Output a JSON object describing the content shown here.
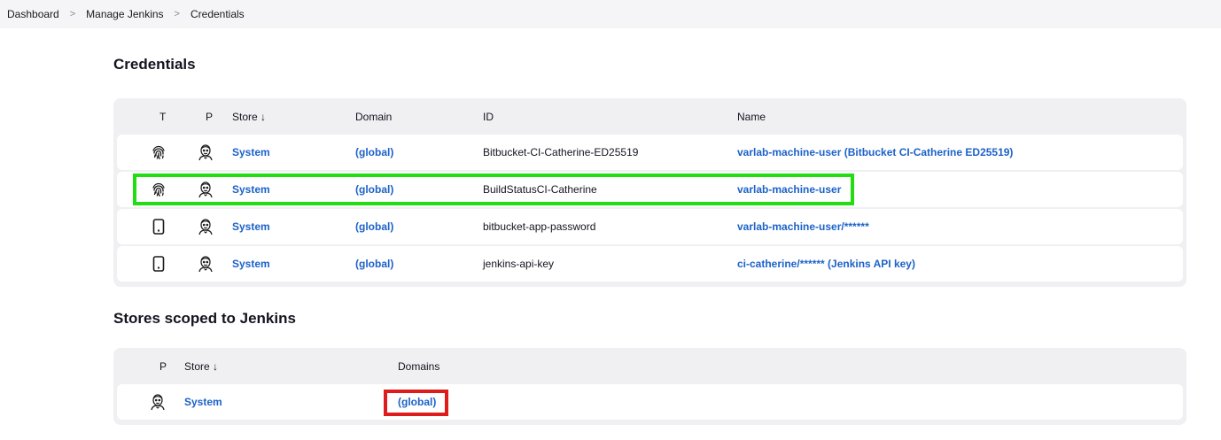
{
  "breadcrumb": [
    "Dashboard",
    "Manage Jenkins",
    "Credentials"
  ],
  "breadcrumb_separator": ">",
  "credentials": {
    "title": "Credentials",
    "columns": {
      "t": "T",
      "p": "P",
      "store": "Store ↓",
      "domain": "Domain",
      "id": "ID",
      "name": "Name"
    },
    "rows": [
      {
        "type_icon": "fingerprint-icon",
        "provider_icon": "jenkins-butler-icon",
        "store": "System",
        "domain": "(global)",
        "id": "Bitbucket-CI-Catherine-ED25519",
        "name": "varlab-machine-user (Bitbucket CI-Catherine ED25519)"
      },
      {
        "type_icon": "fingerprint-icon",
        "provider_icon": "jenkins-butler-icon",
        "store": "System",
        "domain": "(global)",
        "id": "BuildStatusCI-Catherine",
        "name": "varlab-machine-user"
      },
      {
        "type_icon": "mobile-device-icon",
        "provider_icon": "jenkins-butler-icon",
        "store": "System",
        "domain": "(global)",
        "id": "bitbucket-app-password",
        "name": "varlab-machine-user/******"
      },
      {
        "type_icon": "mobile-device-icon",
        "provider_icon": "jenkins-butler-icon",
        "store": "System",
        "domain": "(global)",
        "id": "jenkins-api-key",
        "name": "ci-catherine/****** (Jenkins API key)"
      }
    ]
  },
  "stores": {
    "title": "Stores scoped to Jenkins",
    "columns": {
      "p": "P",
      "store": "Store ↓",
      "domains": "Domains"
    },
    "rows": [
      {
        "provider_icon": "jenkins-butler-icon",
        "store": "System",
        "domains": "(global)"
      }
    ]
  },
  "highlights": {
    "green": "#22dd11",
    "red": "#e01b1b"
  },
  "colors": {
    "link": "#1c62c9",
    "table_bg": "#f0f0f3",
    "breadcrumb_bg": "#f5f5f7"
  }
}
